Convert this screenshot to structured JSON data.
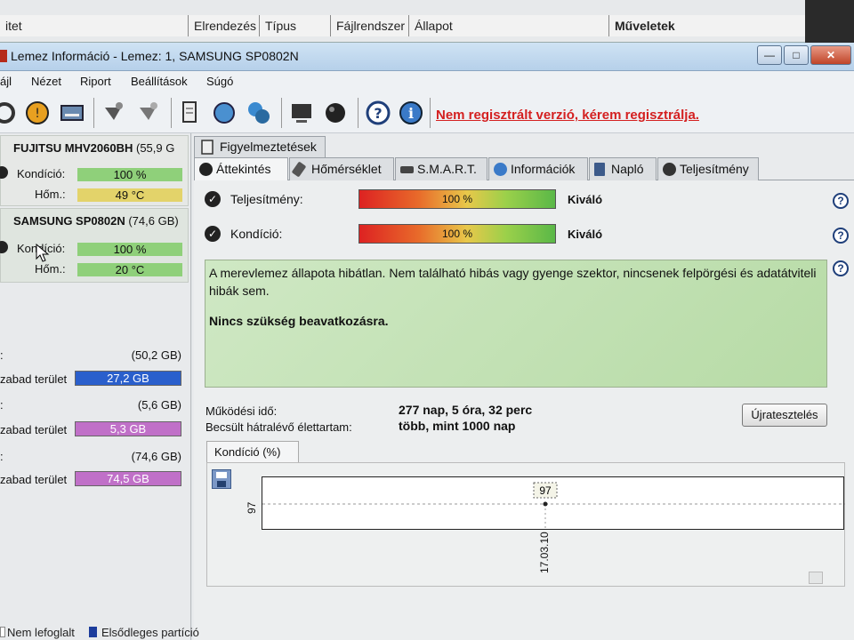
{
  "background_window": {
    "columns": [
      "itet",
      "Elrendezés",
      "Típus",
      "Fájlrendszer",
      "Állapot",
      "Műveletek"
    ]
  },
  "window": {
    "title": "Lemez Információ - Lemez: 1, SAMSUNG SP0802N",
    "controls": {
      "minimize": "—",
      "maximize": "□",
      "close": "✕"
    }
  },
  "menu": [
    "ájl",
    "Nézet",
    "Riport",
    "Beállítások",
    "Súgó"
  ],
  "toolbar": {
    "icons": [
      "refresh-icon",
      "warning-icon",
      "disk-icon",
      "satellite-icon",
      "satellite-icon",
      "document-icon",
      "recycle-icon",
      "network-icon",
      "computer-icon",
      "sphere-icon",
      "help-icon",
      "info-icon"
    ],
    "unregistered_text": "Nem regisztrált verzió, kérem regisztrálja."
  },
  "disks": [
    {
      "name": "FUJITSU MHV2060BH",
      "size": "(55,9 G",
      "condition_label": "Kondíció:",
      "condition_value": "100 %",
      "temp_label": "Hőm.:",
      "temp_value": "49 °C",
      "temp_color": "#e3d36a"
    },
    {
      "name": "SAMSUNG SP0802N",
      "size": "(74,6 GB)",
      "condition_label": "Kondíció:",
      "condition_value": "100 %",
      "temp_label": "Hőm.:",
      "temp_value": "20 °C",
      "temp_color": "#8fd07a"
    }
  ],
  "partitions": [
    {
      "prefix": ":",
      "size": "(50,2 GB)",
      "free_label": "zabad terület",
      "free_value": "27,2 GB",
      "bar_color": "#2a5fcc"
    },
    {
      "prefix": ":",
      "size": "(5,6 GB)",
      "free_label": "zabad terület",
      "free_value": "5,3 GB",
      "bar_color": "#c070c8"
    },
    {
      "prefix": ":",
      "size": "(74,6 GB)",
      "free_label": "zabad terület",
      "free_value": "74,5 GB",
      "bar_color": "#c070c8"
    }
  ],
  "top_tab": "Figyelmeztetések",
  "tabs": [
    "Áttekintés",
    "Hőmérséklet",
    "S.M.A.R.T.",
    "Információk",
    "Napló",
    "Teljesítmény"
  ],
  "overview": {
    "performance_label": "Teljesítmény:",
    "performance_value": "100 %",
    "performance_rating": "Kiváló",
    "condition_label": "Kondíció:",
    "condition_value": "100 %",
    "condition_rating": "Kiváló",
    "description_line1": "A merevlemez állapota hibátlan. Nem található hibás vagy gyenge szektor, nincsenek felpörgési és adatátviteli hibák sem.",
    "description_line2": "Nincs szükség beavatkozásra.",
    "uptime_label": "Működési idő:",
    "uptime_value": "277 nap, 5 óra, 32 perc",
    "lifetime_label": "Becsült hátralévő élettartam:",
    "lifetime_value": "több, mint 1000 nap",
    "retest_button": "Újratesztelés"
  },
  "chart_tab": "Kondíció  (%)",
  "chart_data": {
    "type": "line",
    "x": [
      "17.03.10"
    ],
    "series": [
      {
        "values": [
          97
        ]
      }
    ],
    "y_tick_label": "97",
    "point_label": "97"
  },
  "legend": {
    "unallocated": "Nem lefoglalt",
    "primary": "Elsődleges partíció",
    "primary_color": "#1c3c9c"
  }
}
